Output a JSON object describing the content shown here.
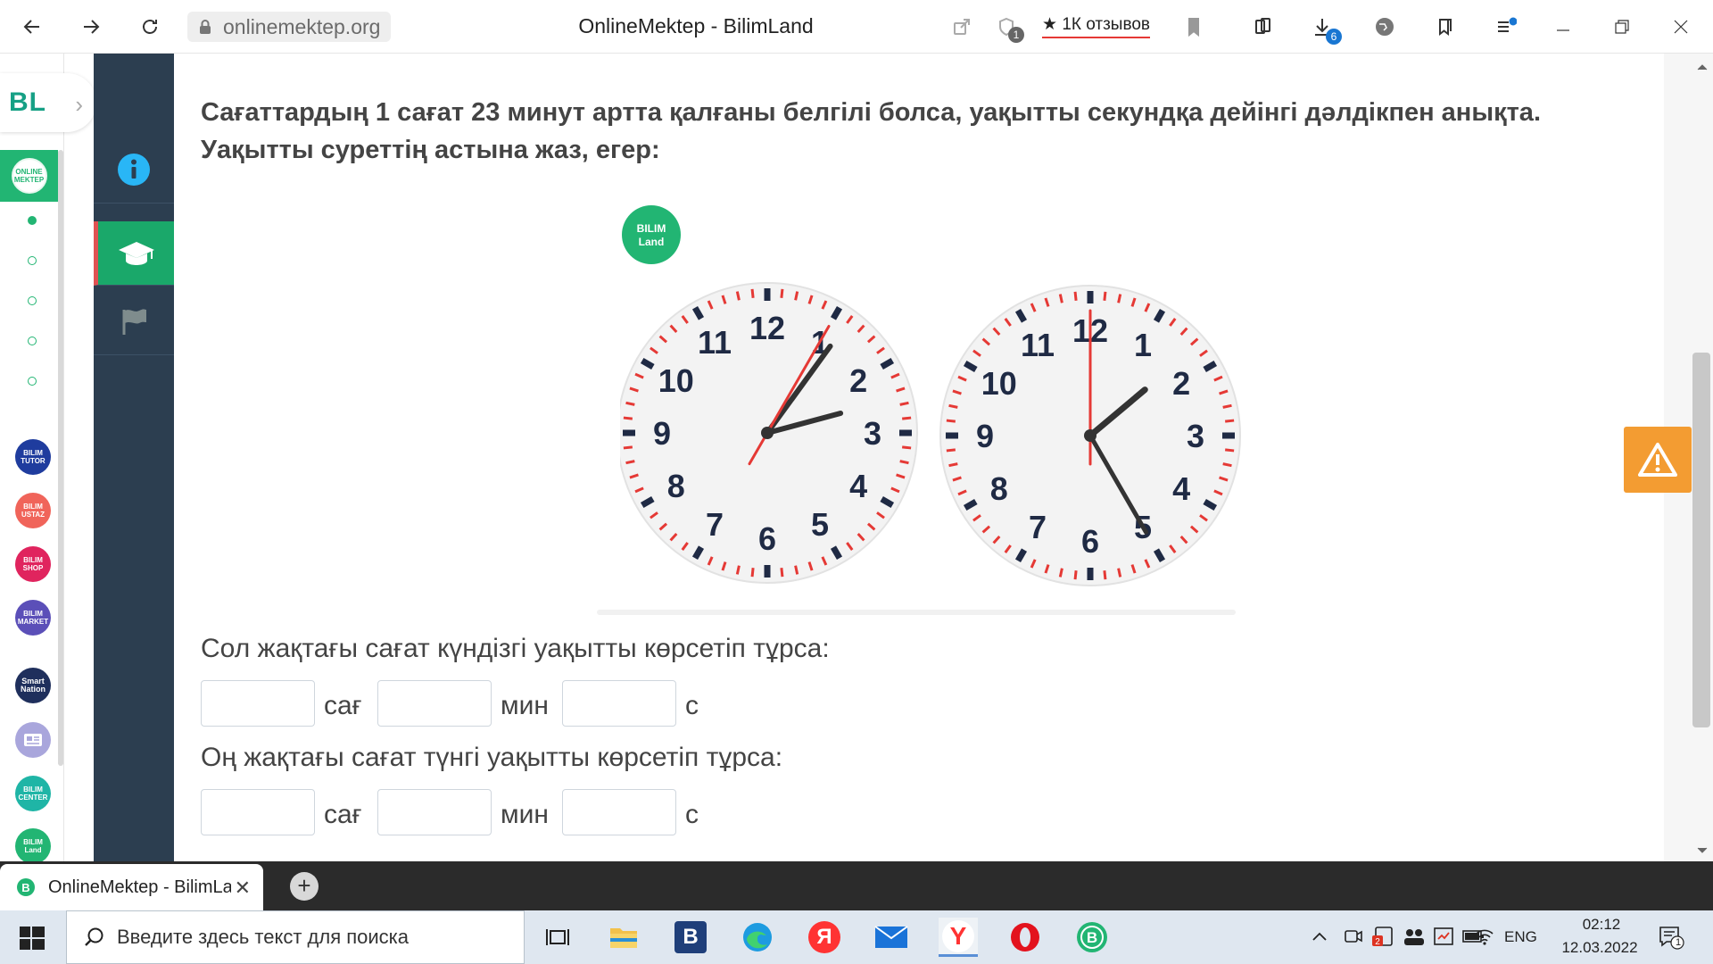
{
  "browser": {
    "url": "onlinemektep.org",
    "title": "OnlineMektep - BilimLand",
    "reviews_label": "1К отзывов",
    "downloads_count": "6",
    "protect_count": "1"
  },
  "rail": {
    "logo_text": "BL",
    "services": [
      {
        "name": "online-mektep",
        "label": "ONLINE MEKTEP",
        "color": "#22b573"
      },
      {
        "name": "bilim-tutor",
        "label": "BILIM TUTOR",
        "color": "#1f3c9e"
      },
      {
        "name": "bilim-ustaz",
        "label": "BILIM USTAZ",
        "color": "#f0645a"
      },
      {
        "name": "bilim-shop",
        "label": "BILIM SHOP",
        "color": "#e0245e"
      },
      {
        "name": "bilim-market",
        "label": "BILIM MARKET",
        "color": "#5b4fb8"
      },
      {
        "name": "smart-nation",
        "label": "Smart Nation",
        "color": "#1f2f5c"
      },
      {
        "name": "bilim-news",
        "label": "",
        "color": "#a9a6dc"
      },
      {
        "name": "bilim-center",
        "label": "BILIM CENTER",
        "color": "#1fb5a6"
      },
      {
        "name": "bilim-land",
        "label": "BILIM Land",
        "color": "#22b573"
      }
    ]
  },
  "sidenav": {
    "items": [
      "info-icon",
      "graduation-cap-icon",
      "flag-icon"
    ],
    "active_index": 1
  },
  "lesson": {
    "question": "Сағаттардың 1 сағат 23 минут артта қалғаны белгілі болса, уақытты секундқа дейінгі дәлдікпен анықта. Уақытты суреттің астына жаз, егер:",
    "image_logo": "BILIM Land",
    "clock_numbers": [
      "12",
      "1",
      "2",
      "3",
      "4",
      "5",
      "6",
      "7",
      "8",
      "9",
      "10",
      "11"
    ],
    "left_prompt": "Сол жақтағы сағат күндізгі уақытты көрсетіп тұрса:",
    "right_prompt": "Оң жақтағы сағат түнгі уақытты көрсетіп тұрса:",
    "unit_hour": "сағ",
    "unit_min": "мин",
    "unit_sec": "с",
    "answers_left": {
      "hours": "",
      "minutes": "",
      "seconds": ""
    },
    "answers_right": {
      "hours": "",
      "minutes": "",
      "seconds": ""
    }
  },
  "tabstrip": {
    "tab_title": "OnlineMektep - BilimLand",
    "new_tab": "+"
  },
  "taskbar": {
    "search_placeholder": "Введите здесь текст для поиска",
    "lang": "ENG",
    "time": "02:12",
    "date": "12.03.2022",
    "notifications": "1",
    "apps": [
      {
        "name": "task-view-icon",
        "label": ""
      },
      {
        "name": "file-explorer-icon",
        "label": ""
      },
      {
        "name": "b-app-icon",
        "label": "B"
      },
      {
        "name": "edge-icon",
        "label": ""
      },
      {
        "name": "yandex-icon",
        "label": "Я"
      },
      {
        "name": "mail-icon",
        "label": ""
      },
      {
        "name": "yandex-browser-icon",
        "label": "Y"
      },
      {
        "name": "opera-icon",
        "label": ""
      },
      {
        "name": "bilimland-app-icon",
        "label": ""
      }
    ]
  },
  "colors": {
    "accent_green": "#22b573",
    "nav_dark": "#2c3e50",
    "warning_orange": "#f39c32",
    "clock_red": "#e53935"
  }
}
